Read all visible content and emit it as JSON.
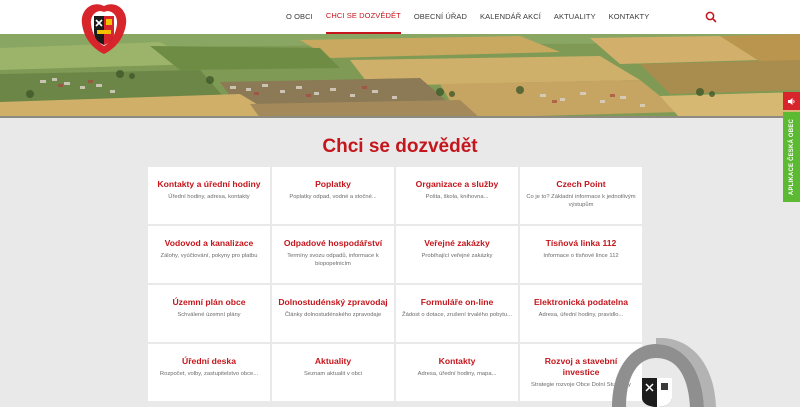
{
  "nav": {
    "items": [
      {
        "label": "O OBCI",
        "active": false
      },
      {
        "label": "CHCI SE DOZVĚDĚT",
        "active": true
      },
      {
        "label": "OBECNÍ ÚŘAD",
        "active": false
      },
      {
        "label": "KALENDÁŘ AKCÍ",
        "active": false
      },
      {
        "label": "AKTUALITY",
        "active": false
      },
      {
        "label": "KONTAKTY",
        "active": false
      }
    ]
  },
  "side": {
    "app_label": "APLIKACE ČESKÁ OBEC"
  },
  "page": {
    "title": "Chci se dozvědět"
  },
  "cards": [
    {
      "title": "Kontakty a úřední hodiny",
      "desc": "Úřední hodiny, adresa, kontakty"
    },
    {
      "title": "Poplatky",
      "desc": "Poplatky odpad, vodné a stočné..."
    },
    {
      "title": "Organizace a služby",
      "desc": "Pošta, škola, knihovna..."
    },
    {
      "title": "Czech Point",
      "desc": "Co je to? Základní informace k jednotlivým výstupům"
    },
    {
      "title": "Vodovod a kanalizace",
      "desc": "Zálohy, vyúčtování, pokyny pro platbu"
    },
    {
      "title": "Odpadové hospodářství",
      "desc": "Termíny svozu odpadů, informace k biopopelnicím"
    },
    {
      "title": "Veřejné zakázky",
      "desc": "Probíhající veřejné zakázky"
    },
    {
      "title": "Tísňová linka 112",
      "desc": "Informace o tísňové lince 112"
    },
    {
      "title": "Územní plán obce",
      "desc": "Schválené územní plány"
    },
    {
      "title": "Dolnostudénský zpravodaj",
      "desc": "Články dolnostudénského zpravodaje"
    },
    {
      "title": "Formuláře on-line",
      "desc": "Žádost o dotace, zrušení trvalého pobytu..."
    },
    {
      "title": "Elektronická podatelna",
      "desc": "Adresa, úřední hodiny, pravidlo..."
    },
    {
      "title": "Úřední deska",
      "desc": "Rozpočet, volby, zastupitelstvo obce..."
    },
    {
      "title": "Aktuality",
      "desc": "Seznam aktualit v obci"
    },
    {
      "title": "Kontakty",
      "desc": "Adresa, úřední hodiny, mapa..."
    },
    {
      "title": "Rozvoj a stavební investice",
      "desc": "Strategie rozvoje Obce Dolní Studénky"
    }
  ],
  "colors": {
    "accent": "#c4161c",
    "app_tab": "#5bb932",
    "background": "#e9e9e9"
  },
  "icons": {
    "search": "search-icon",
    "speaker": "speaker-icon",
    "logo": "municipal-coat-of-arms-logo"
  }
}
